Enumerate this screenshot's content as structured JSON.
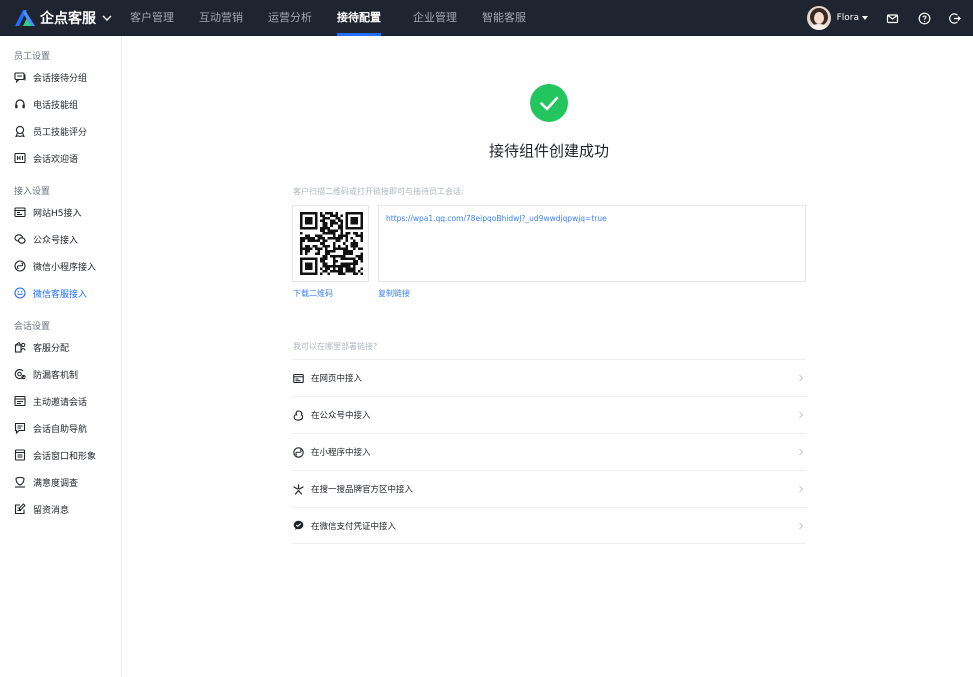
{
  "topbar": {
    "brand": "企点客服",
    "nav": [
      {
        "label": "客户管理",
        "active": false
      },
      {
        "label": "互动营销",
        "active": false
      },
      {
        "label": "运营分析",
        "active": false
      },
      {
        "label": "接待配置",
        "active": true
      },
      {
        "label": "企业管理",
        "active": false
      },
      {
        "label": "智能客服",
        "active": false
      }
    ],
    "user": {
      "name": "Flora"
    },
    "icons": [
      "mail-icon",
      "help-icon",
      "logout-icon"
    ]
  },
  "sidebar": {
    "groups": [
      {
        "title": "员工设置",
        "items": [
          {
            "label": "会话接待分组",
            "icon": "chat-group-icon"
          },
          {
            "label": "电话技能组",
            "icon": "headset-icon"
          },
          {
            "label": "员工技能评分",
            "icon": "badge-icon"
          },
          {
            "label": "会话欢迎语",
            "icon": "welcome-icon"
          }
        ]
      },
      {
        "title": "接入设置",
        "items": [
          {
            "label": "网站H5接入",
            "icon": "web-icon"
          },
          {
            "label": "公众号接入",
            "icon": "official-account-icon"
          },
          {
            "label": "微信小程序接入",
            "icon": "mini-program-icon"
          },
          {
            "label": "微信客服接入",
            "icon": "wechat-service-icon",
            "active": true
          }
        ]
      },
      {
        "title": "会话设置",
        "items": [
          {
            "label": "客服分配",
            "icon": "assign-icon"
          },
          {
            "label": "防漏客机制",
            "icon": "guard-icon"
          },
          {
            "label": "主动邀请会话",
            "icon": "invite-icon"
          },
          {
            "label": "会话自助导航",
            "icon": "navigation-icon"
          },
          {
            "label": "会话窗口和形象",
            "icon": "window-icon"
          },
          {
            "label": "满意度调查",
            "icon": "satisfaction-icon"
          },
          {
            "label": "留资消息",
            "icon": "leave-message-icon"
          }
        ]
      }
    ]
  },
  "main": {
    "title": "接待组件创建成功",
    "qr_hint": "客户扫描二维码或打开链接即可与接待员工会话:",
    "link": "https://wpa1.qq.com/78eipqoBhidwJ?_ud9wwdjqpwjq=true",
    "download_qr": "下载二维码",
    "copy_link": "复制链接",
    "deploy_hint": "我可以在哪里部署链接?",
    "deploy_options": [
      {
        "label": "在网页中接入",
        "icon": "webpage-icon"
      },
      {
        "label": "在公众号中接入",
        "icon": "official-account-icon"
      },
      {
        "label": "在小程序中接入",
        "icon": "mini-program-icon"
      },
      {
        "label": "在搜一搜品牌官方区中接入",
        "icon": "sousou-icon"
      },
      {
        "label": "在微信支付凭证中接入",
        "icon": "wechat-pay-icon"
      }
    ]
  },
  "colors": {
    "topbar_bg": "#1e2430",
    "accent": "#1f6fff",
    "success": "#22c55e",
    "link": "#3b82f6"
  }
}
